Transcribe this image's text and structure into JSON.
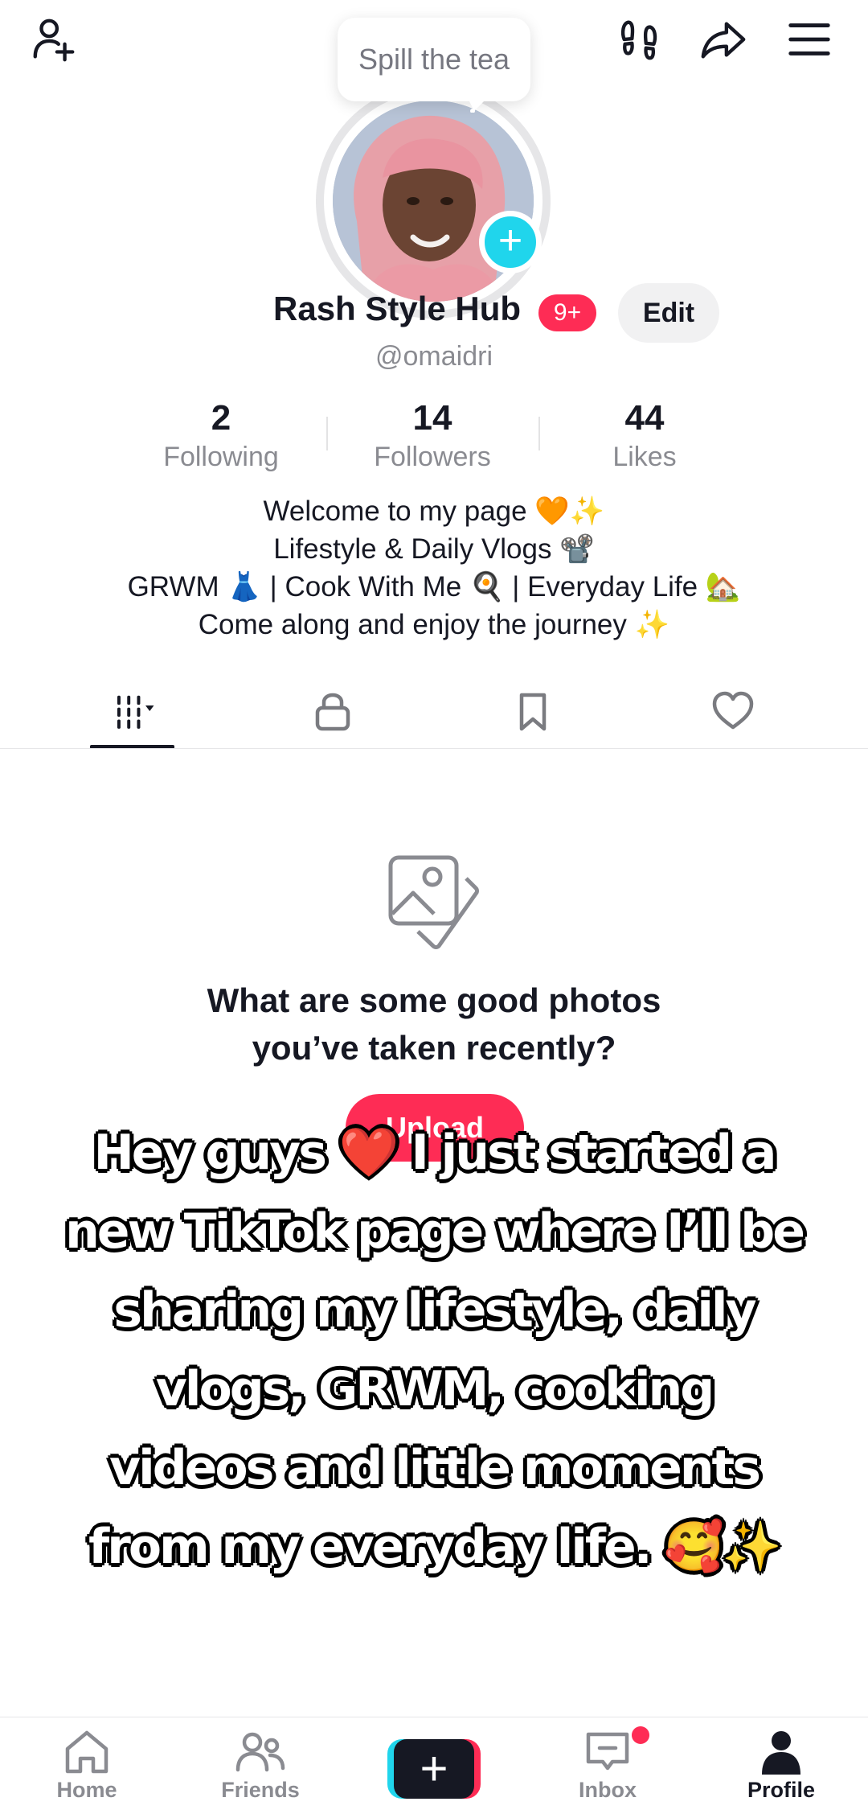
{
  "top_bar": {
    "add_friend_icon": "person-plus-icon",
    "footprint_icon": "footprints-icon",
    "share_icon": "share-arrow-icon",
    "menu_icon": "hamburger-menu-icon"
  },
  "profile": {
    "bubble_text": "Spill the tea",
    "name": "Rash Style Hub",
    "badge": "9+",
    "edit_label": "Edit",
    "handle": "@omaidri"
  },
  "stats": [
    {
      "value": "2",
      "label": "Following"
    },
    {
      "value": "14",
      "label": "Followers"
    },
    {
      "value": "44",
      "label": "Likes"
    }
  ],
  "bio": [
    "Welcome to my page 🧡✨",
    "Lifestyle & Daily Vlogs 📽️",
    "GRWM 👗 | Cook With Me 🍳 | Everyday Life 🏡",
    "Come along and enjoy the journey ✨"
  ],
  "tabs": [
    {
      "icon": "grid-videos-icon",
      "active": true
    },
    {
      "icon": "lock-icon",
      "active": false
    },
    {
      "icon": "bookmark-icon",
      "active": false
    },
    {
      "icon": "heart-icon",
      "active": false
    }
  ],
  "empty_state": {
    "icon": "photos-icon",
    "title_line1": "What are some good photos",
    "title_line2": "you’ve taken recently?",
    "button_label": "Upload"
  },
  "caption": [
    "Hey guys ❤️ I just started a",
    "new TikTok page where I’ll be",
    "sharing my lifestyle, daily",
    "vlogs, GRWM, cooking",
    "videos and little moments",
    "from my everyday life. 🥰✨"
  ],
  "bottom_nav": [
    {
      "label": "Home",
      "icon": "home-icon"
    },
    {
      "label": "Friends",
      "icon": "friends-icon"
    },
    {
      "label": "",
      "icon": "create-plus-icon"
    },
    {
      "label": "Inbox",
      "icon": "inbox-icon"
    },
    {
      "label": "Profile",
      "icon": "profile-icon"
    }
  ],
  "colors": {
    "accent_red": "#fe2c55",
    "accent_cyan": "#20d5ec",
    "text_primary": "#161823",
    "text_secondary": "#8a8b91"
  }
}
